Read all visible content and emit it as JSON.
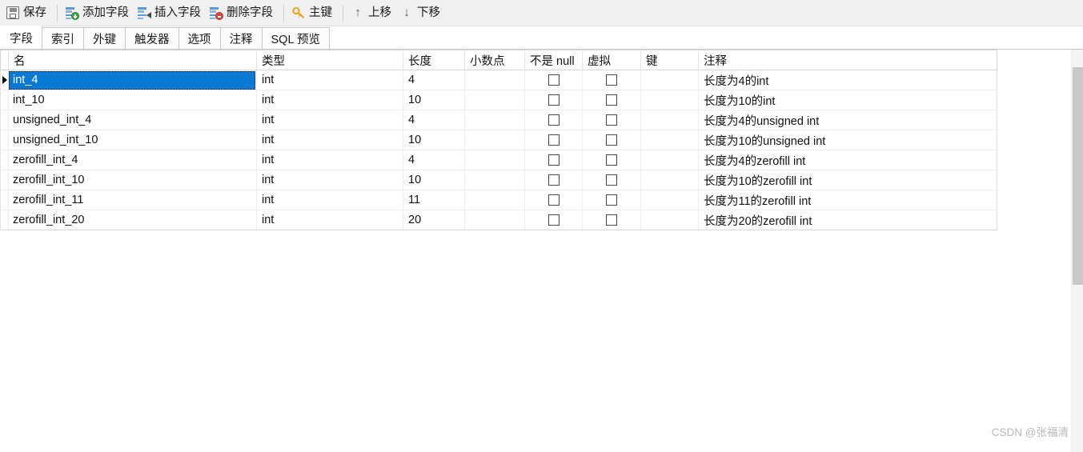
{
  "toolbar": {
    "buttons": [
      {
        "label": "保存",
        "icon": "save-icon"
      },
      {
        "label": "添加字段",
        "icon": "add-field-icon"
      },
      {
        "label": "插入字段",
        "icon": "insert-field-icon"
      },
      {
        "label": "删除字段",
        "icon": "delete-field-icon"
      },
      {
        "label": "主键",
        "icon": "primary-key-icon"
      },
      {
        "label": "上移",
        "icon": "arrow-up-icon"
      },
      {
        "label": "下移",
        "icon": "arrow-down-icon"
      }
    ]
  },
  "tabs": {
    "items": [
      {
        "label": "字段",
        "active": true
      },
      {
        "label": "索引",
        "active": false
      },
      {
        "label": "外键",
        "active": false
      },
      {
        "label": "触发器",
        "active": false
      },
      {
        "label": "选项",
        "active": false
      },
      {
        "label": "注释",
        "active": false
      },
      {
        "label": "SQL 预览",
        "active": false
      }
    ]
  },
  "grid": {
    "columns": [
      "名",
      "类型",
      "长度",
      "小数点",
      "不是 null",
      "虚拟",
      "键",
      "注释"
    ],
    "rows": [
      {
        "name": "int_4",
        "type": "int",
        "length": "4",
        "decimals": "",
        "not_null": false,
        "virtual": false,
        "key": "",
        "comment": "长度为4的int",
        "selected": true
      },
      {
        "name": "int_10",
        "type": "int",
        "length": "10",
        "decimals": "",
        "not_null": false,
        "virtual": false,
        "key": "",
        "comment": "长度为10的int",
        "selected": false
      },
      {
        "name": "unsigned_int_4",
        "type": "int",
        "length": "4",
        "decimals": "",
        "not_null": false,
        "virtual": false,
        "key": "",
        "comment": "长度为4的unsigned int",
        "selected": false
      },
      {
        "name": "unsigned_int_10",
        "type": "int",
        "length": "10",
        "decimals": "",
        "not_null": false,
        "virtual": false,
        "key": "",
        "comment": "长度为10的unsigned int",
        "selected": false
      },
      {
        "name": "zerofill_int_4",
        "type": "int",
        "length": "4",
        "decimals": "",
        "not_null": false,
        "virtual": false,
        "key": "",
        "comment": "长度为4的zerofill int",
        "selected": false
      },
      {
        "name": "zerofill_int_10",
        "type": "int",
        "length": "10",
        "decimals": "",
        "not_null": false,
        "virtual": false,
        "key": "",
        "comment": "长度为10的zerofill int",
        "selected": false
      },
      {
        "name": "zerofill_int_11",
        "type": "int",
        "length": "11",
        "decimals": "",
        "not_null": false,
        "virtual": false,
        "key": "",
        "comment": "长度为11的zerofill int",
        "selected": false
      },
      {
        "name": "zerofill_int_20",
        "type": "int",
        "length": "20",
        "decimals": "",
        "not_null": false,
        "virtual": false,
        "key": "",
        "comment": "长度为20的zerofill int",
        "selected": false
      }
    ]
  },
  "watermark": {
    "text": "CSDN @张福清"
  },
  "colors": {
    "selection": "#0a79d4",
    "toolbar_bg": "#f0f0f0",
    "accent_list": "#5b9bd5",
    "add_badge": "#3ea93e",
    "delete_badge": "#d94a3d",
    "key_gold": "#e8a91d"
  }
}
